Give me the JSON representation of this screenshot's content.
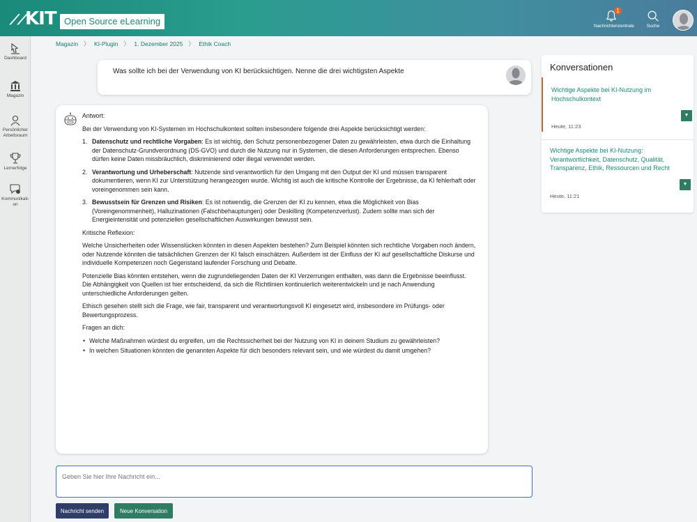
{
  "header": {
    "logo": "KIT",
    "app_title": "Open Source eLearning",
    "notifications": {
      "label": "Nachrichtenzentrale",
      "count": "1"
    },
    "search_label": "Suche"
  },
  "sidebar": {
    "items": [
      {
        "label": "Dashboard"
      },
      {
        "label": "Magazin"
      },
      {
        "label": "Persönlicher Arbeitsraum"
      },
      {
        "label": "Lernerfolge"
      },
      {
        "label": "Kommunikati-on"
      }
    ]
  },
  "breadcrumb": [
    "Magazin",
    "KI-Plugin",
    "1. Dezember 2025",
    "Ethik Coach"
  ],
  "question": "Was sollte ich bei der Verwendung von KI berücksichtigen. Nenne die drei wichtigsten Aspekte",
  "answer": {
    "label": "Antwort:",
    "intro": "Bei der Verwendung von KI-Systemen im Hochschulkontext sollten insbesondere folgende drei Aspekte berücksichtigt werden:",
    "points": [
      {
        "num": "1.",
        "title": "Datenschutz und rechtliche Vorgaben",
        "text": ": Es ist wichtig, den Schutz personenbezogener Daten zu gewährleisten, etwa durch die Einhaltung der Datenschutz-Grundverordnung (DS-GVO) und durch die Nutzung nur in Systemen, die diesen Anforderungen entsprechen. Ebenso dürfen keine Daten missbräuchlich, diskriminierend oder illegal verwendet werden."
      },
      {
        "num": "2.",
        "title": "Verantwortung und Urheberschaft",
        "text": ": Nutzende sind verantwortlich für den Umgang mit den Output der KI und müssen transparent dokumentieren, wenn KI zur Unterstützung herangezogen wurde. Wichtig ist auch die kritische Kontrolle der Ergebnisse, da KI fehlerhaft oder voreingenommen sein kann."
      },
      {
        "num": "3.",
        "title": "Bewusstsein für Grenzen und Risiken",
        "text": ": Es ist notwendig, die Grenzen der KI zu kennen, etwa die Möglichkeit von Bias (Voreingenommenheit), Halluzinationen (Falschbehauptungen) oder Deskilling (Kompetenzverlust). Zudem sollte man sich der Energieintensität und potenziellen gesellschaftlichen Auswirkungen bewusst sein."
      }
    ],
    "reflection_heading": "Kritische Reflexion:",
    "reflection_paragraphs": [
      "Welche Unsicherheiten oder Wissenslücken könnten in diesen Aspekten bestehen? Zum Beispiel könnten sich rechtliche Vorgaben noch ändern, oder Nutzende könnten die tatsächlichen Grenzen der KI falsch einschätzen. Außerdem ist der Einfluss der KI auf gesellschaftliche Diskurse und individuelle Kompetenzen noch Gegenstand laufender Forschung und Debatte.",
      "Potenzielle Bias könnten entstehen, wenn die zugrundeliegenden Daten der KI Verzerrungen enthalten, was dann die Ergebnisse beeinflusst. Die Abhängigkeit von Quellen ist hier entscheidend, da sich die Richtlinien kontinuierlich weiterentwickeln und je nach Anwendung unterschiedliche Anforderungen gelten.",
      "Ethisch gesehen stellt sich die Frage, wie fair, transparent und verantwortungsvoll KI eingesetzt wird, insbesondere im Prüfungs- oder Bewertungsprozess."
    ],
    "questions_heading": "Fragen an dich:",
    "questions": [
      "Welche Maßnahmen würdest du ergreifen, um die Rechtssicherheit bei der Nutzung von KI in deinem Studium zu gewährleisten?",
      "In welchen Situationen könnten die genannten Aspekte für dich besonders relevant sein, und wie würdest du damit umgehen?"
    ]
  },
  "composer": {
    "placeholder": "Geben Sie hier Ihre Nachricht ein...",
    "send_label": "Nachricht senden",
    "new_label": "Neue Konversation"
  },
  "conversations": {
    "title": "Konversationen",
    "items": [
      {
        "title": "Wichtige Aspekte bei KI-Nutzung im Hochschulkontext",
        "time": "Heute, 11:23"
      },
      {
        "title": "Wichtige Aspekte bei KI-Nutzung: Verantwortlichkeit, Datenschutz, Qualität, Transparenz, Ethik, Ressourcen und Recht",
        "time": "Heute, 11:21"
      }
    ]
  },
  "colors": {
    "header_teal": "#2a9d8f",
    "link_green": "#1a8a7a",
    "send_button": "#2f3d6b",
    "new_button": "#2e7d62",
    "active_border": "#b86a3a",
    "badge": "#e0622f"
  }
}
